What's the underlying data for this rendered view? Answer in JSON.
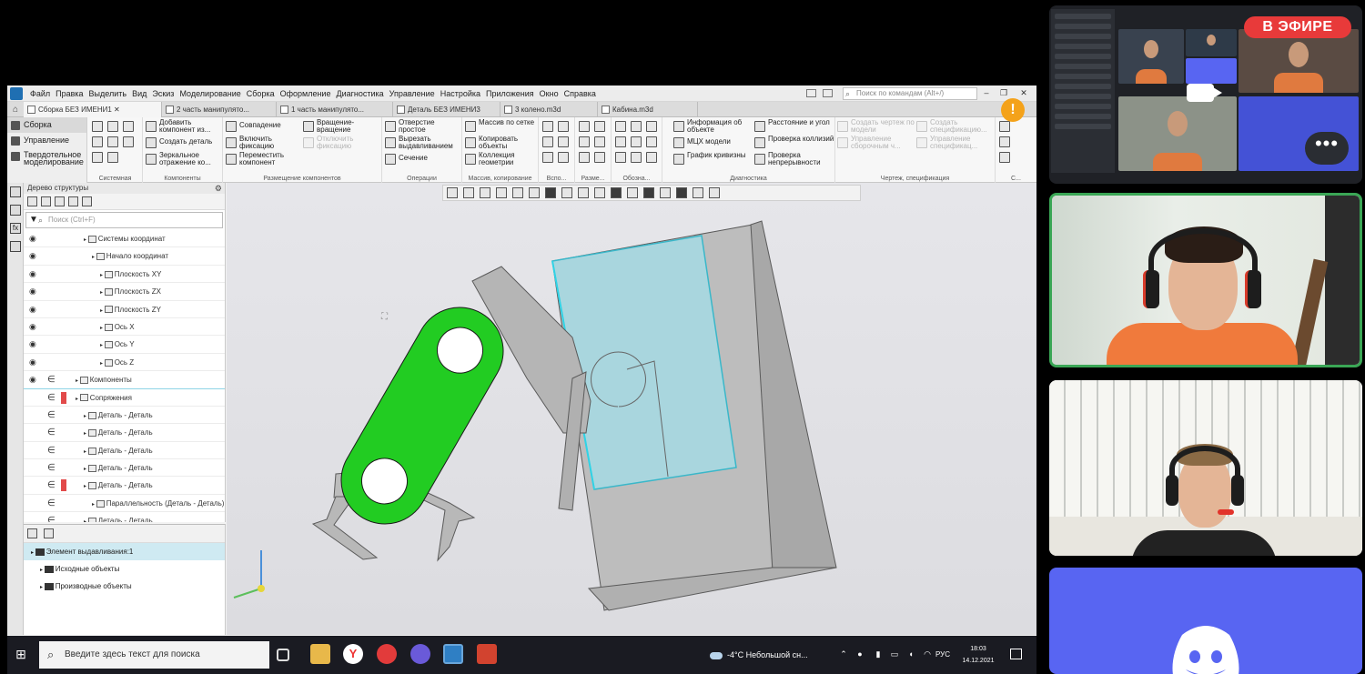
{
  "app": {
    "menu": [
      "Файл",
      "Правка",
      "Выделить",
      "Вид",
      "Эскиз",
      "Моделирование",
      "Сборка",
      "Оформление",
      "Диагностика",
      "Управление",
      "Настройка",
      "Приложения",
      "Окно",
      "Справка"
    ],
    "command_search_placeholder": "Поиск по командам (Alt+/)",
    "tabs": [
      "Сборка БЕЗ ИМЕНИ1",
      "2 часть манипулято...",
      "1 часть манипулято...",
      "Деталь БЕЗ ИМЕНИ3",
      "3 колено.m3d",
      "Кабина.m3d"
    ],
    "modes": [
      "Сборка",
      "Управление",
      "Твердотельное моделирование"
    ],
    "ribbon": {
      "system": {
        "caption": "Системная"
      },
      "components": {
        "caption": "Компоненты",
        "buttons": [
          "Добавить компонент из...",
          "Создать деталь",
          "Зеркальное отражение ко..."
        ]
      },
      "placement": {
        "caption": "Размещение компонентов",
        "buttons": [
          "Совпадение",
          "Включить фиксацию",
          "Переместить компонент",
          "Вращение-вращение",
          "Отключить фиксацию"
        ]
      },
      "operations": {
        "caption": "Операции",
        "buttons": [
          "Отверстие простое",
          "Вырезать выдавливанием",
          "Сечение"
        ]
      },
      "mass": {
        "caption": "Массив, копирование",
        "buttons": [
          "Массив по сетке",
          "Копировать объекты",
          "Коллекция геометрии"
        ]
      },
      "small_groups": [
        "Вспо...",
        "Разме...",
        "Обозна..."
      ],
      "diagnostics": {
        "caption": "Диагностика",
        "buttons": [
          "Информация об объекте",
          "МЦХ модели",
          "График кривизны",
          "Расстояние и угол",
          "Проверка коллизий",
          "Проверка непрерывности"
        ]
      },
      "drawing": {
        "caption": "Чертеж, спецификация",
        "buttons": [
          "Создать чертеж по модели",
          "Создать спецификацию...",
          "Управление сборочным ч...",
          "Управление спецификац..."
        ]
      },
      "last_caption": "С..."
    },
    "tree": {
      "title": "Дерево структуры",
      "search_placeholder": "Поиск (Ctrl+F)",
      "rows": [
        {
          "label": "Системы координат",
          "indent": 2,
          "eye": true,
          "lock": false,
          "error": false
        },
        {
          "label": "Начало координат",
          "indent": 3,
          "eye": true,
          "lock": false,
          "error": false
        },
        {
          "label": "Плоскость XY",
          "indent": 4,
          "eye": true,
          "lock": false,
          "error": false
        },
        {
          "label": "Плоскость ZX",
          "indent": 4,
          "eye": true,
          "lock": false,
          "error": false
        },
        {
          "label": "Плоскость ZY",
          "indent": 4,
          "eye": true,
          "lock": false,
          "error": false
        },
        {
          "label": "Ось X",
          "indent": 4,
          "eye": true,
          "lock": false,
          "error": false
        },
        {
          "label": "Ось Y",
          "indent": 4,
          "eye": true,
          "lock": false,
          "error": false
        },
        {
          "label": "Ось Z",
          "indent": 4,
          "eye": true,
          "lock": false,
          "error": false
        },
        {
          "label": "Компоненты",
          "indent": 1,
          "eye": true,
          "lock": true,
          "error": false
        },
        {
          "label": "Сопряжения",
          "indent": 1,
          "eye": false,
          "lock": true,
          "error": true
        },
        {
          "label": "Деталь - Деталь",
          "indent": 2,
          "eye": false,
          "lock": true,
          "error": false
        },
        {
          "label": "Деталь - Деталь",
          "indent": 2,
          "eye": false,
          "lock": true,
          "error": false
        },
        {
          "label": "Деталь - Деталь",
          "indent": 2,
          "eye": false,
          "lock": true,
          "error": false
        },
        {
          "label": "Деталь - Деталь",
          "indent": 2,
          "eye": false,
          "lock": true,
          "error": false
        },
        {
          "label": "Деталь - Деталь",
          "indent": 2,
          "eye": false,
          "lock": true,
          "error": true
        },
        {
          "label": "Параллельность (Деталь - Деталь)",
          "indent": 3,
          "eye": false,
          "lock": true,
          "error": false
        },
        {
          "label": "Деталь - Деталь",
          "indent": 2,
          "eye": false,
          "lock": true,
          "error": false
        }
      ]
    },
    "objects": {
      "rows": [
        {
          "label": "Элемент выдавливания:1",
          "indent": 0,
          "selected": true
        },
        {
          "label": "Исходные объекты",
          "indent": 1,
          "selected": false
        },
        {
          "label": "Производные объекты",
          "indent": 1,
          "selected": false
        }
      ]
    },
    "colors": {
      "highlight": "#22cc22",
      "face_select": "#a9d6de"
    }
  },
  "taskbar": {
    "search_placeholder": "Введите здесь текст для поиска",
    "weather": "-4°C Небольшой сн...",
    "lang": "РУС",
    "time": "18:03",
    "date": "14.12.2021"
  },
  "call": {
    "live_badge": "В ЭФИРЕ",
    "more": "•••"
  }
}
